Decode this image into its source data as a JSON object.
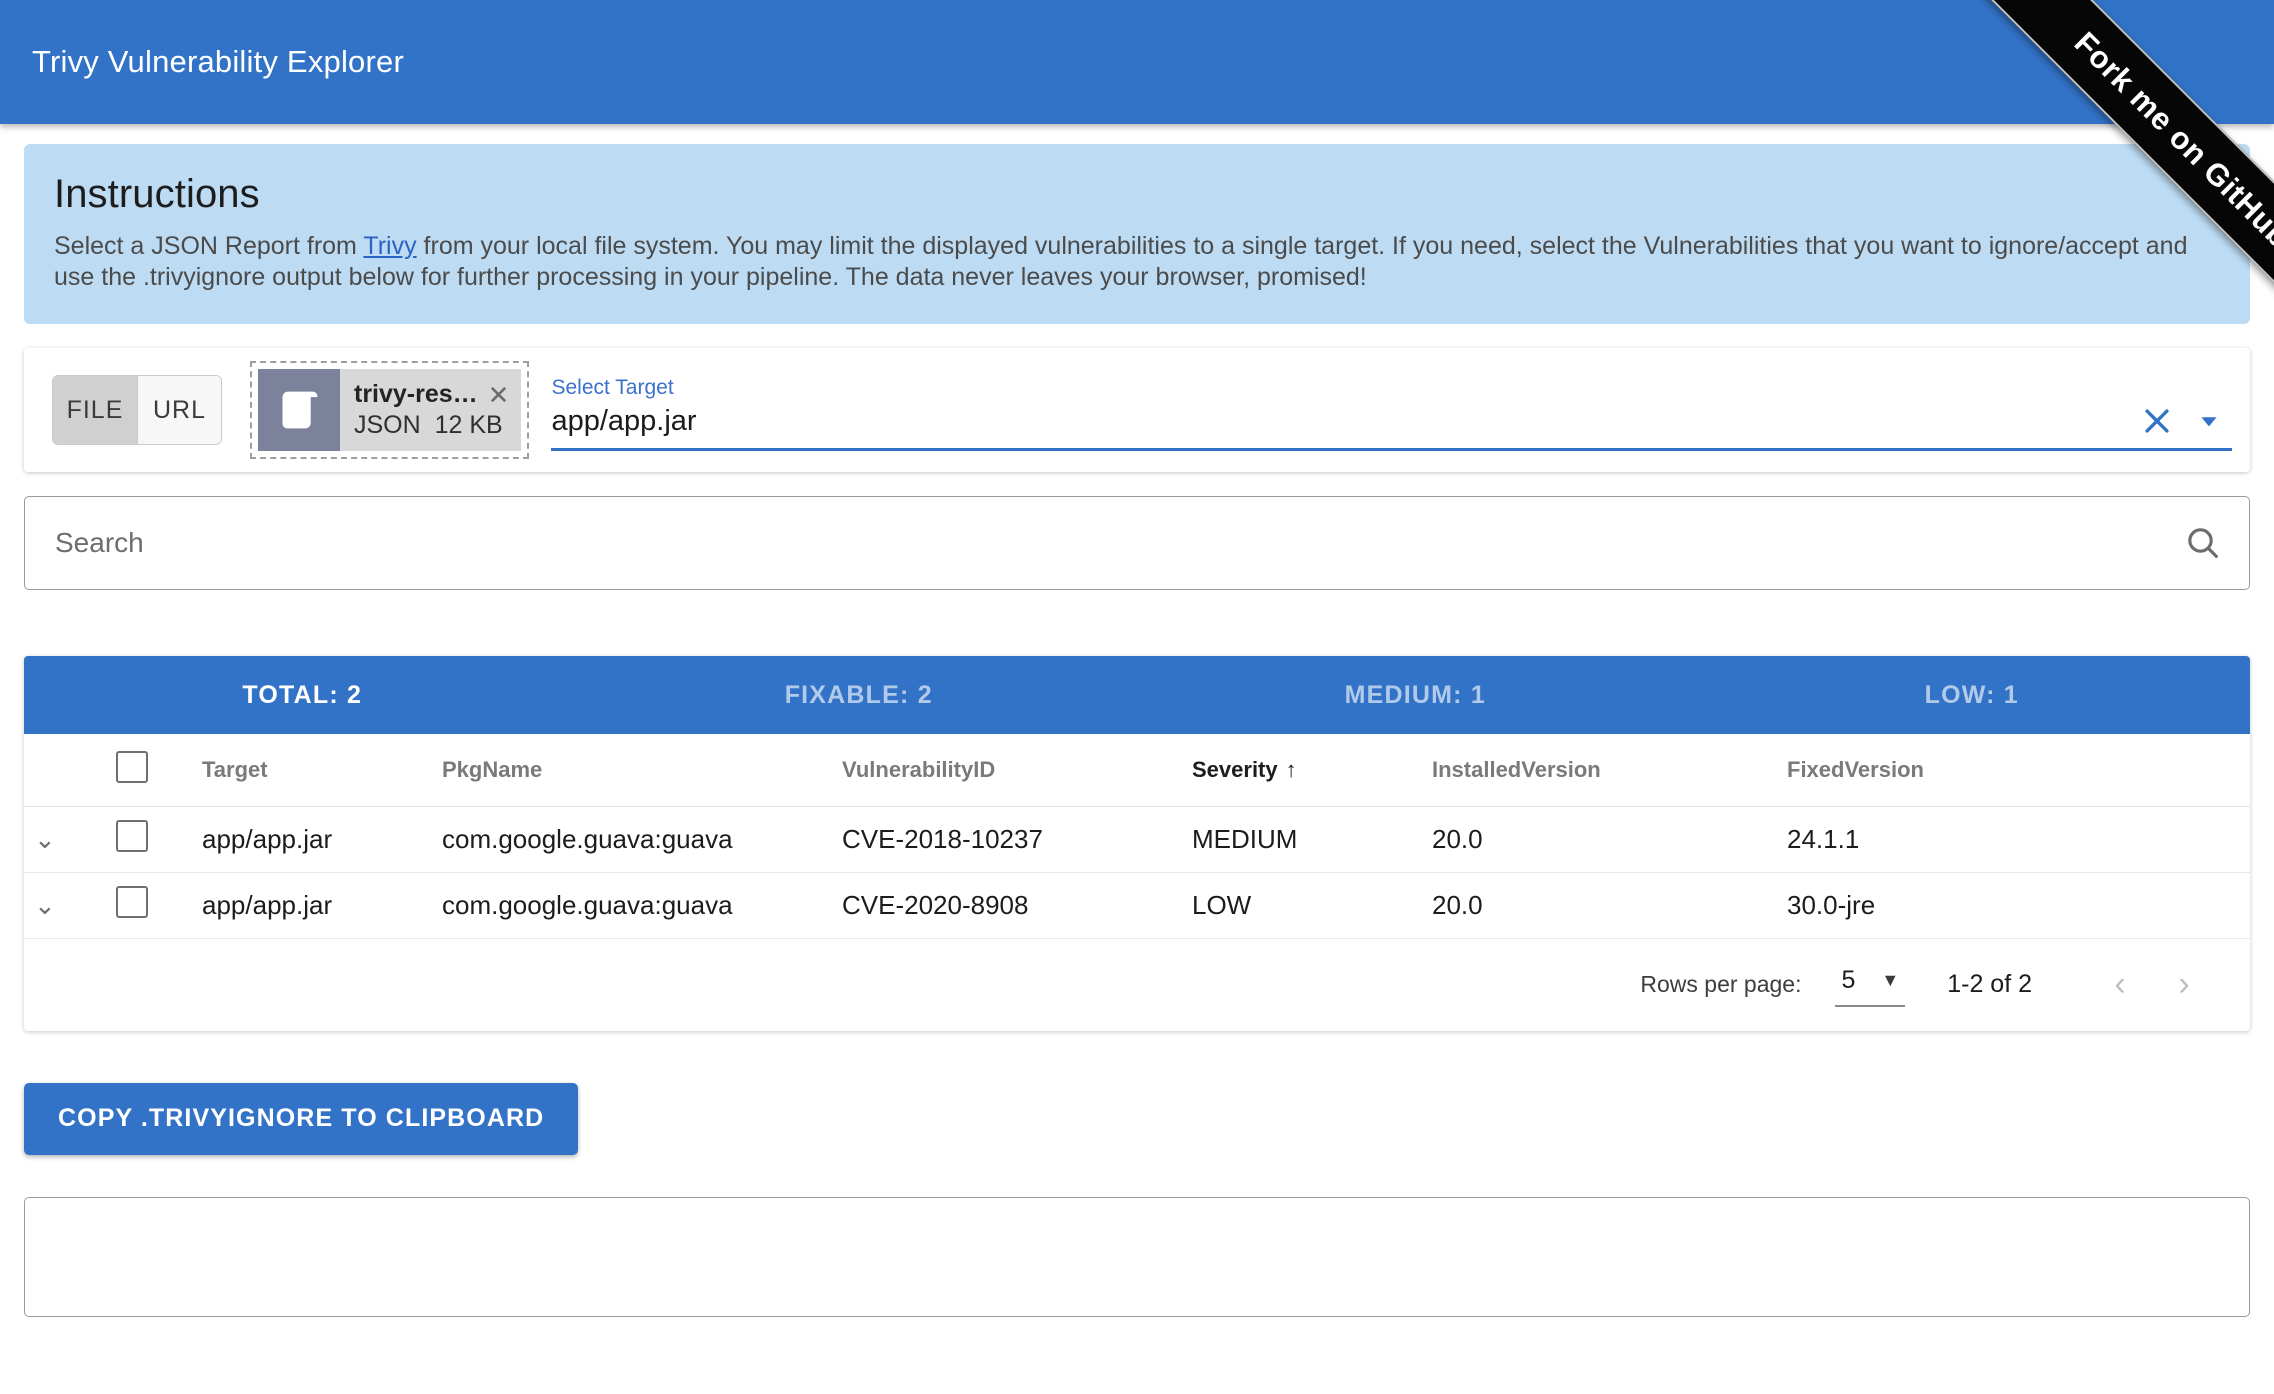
{
  "header": {
    "title": "Trivy Vulnerability Explorer",
    "ribbon_label": "Fork me on GitHub"
  },
  "instructions": {
    "heading": "Instructions",
    "text_before_link": "Select a JSON Report from ",
    "link_label": "Trivy",
    "text_after_link": " from your local file system. You may limit the displayed vulnerabilities to a single target. If you need, select the Vulnerabilities that you want to ignore/accept and use the .trivyignore output below for further processing in your pipeline. The data never leaves your browser, promised!"
  },
  "source": {
    "toggle": {
      "file_label": "FILE",
      "url_label": "URL",
      "selected": "FILE"
    },
    "file_chip": {
      "name": "trivy-res…",
      "type": "JSON",
      "size": "12 KB",
      "icon": "document-icon",
      "close_icon": "close-icon"
    },
    "target": {
      "label": "Select Target",
      "value": "app/app.jar",
      "clear_icon": "close-icon",
      "dropdown_icon": "chevron-down-icon"
    }
  },
  "search": {
    "placeholder": "Search",
    "icon": "search-icon"
  },
  "summary": {
    "total": "TOTAL: 2",
    "fixable": "FIXABLE: 2",
    "medium": "MEDIUM: 1",
    "low": "LOW: 1"
  },
  "table": {
    "columns": {
      "target": "Target",
      "pkgname": "PkgName",
      "vulnerabilityid": "VulnerabilityID",
      "severity": "Severity",
      "severity_sort": "↑",
      "installedversion": "InstalledVersion",
      "fixedversion": "FixedVersion"
    },
    "rows": [
      {
        "target": "app/app.jar",
        "pkgname": "com.google.guava:guava",
        "vulnerabilityid": "CVE-2018-10237",
        "severity": "MEDIUM",
        "installedversion": "20.0",
        "fixedversion": "24.1.1"
      },
      {
        "target": "app/app.jar",
        "pkgname": "com.google.guava:guava",
        "vulnerabilityid": "CVE-2020-8908",
        "severity": "LOW",
        "installedversion": "20.0",
        "fixedversion": "30.0-jre"
      }
    ]
  },
  "paginator": {
    "rows_per_page_label": "Rows per page:",
    "rows_per_page_value": "5",
    "range_label": "1-2 of 2",
    "prev_icon": "chevron-left-icon",
    "next_icon": "chevron-right-icon"
  },
  "actions": {
    "copy_label": "COPY .TRIVYIGNORE TO CLIPBOARD"
  },
  "output": {
    "value": ""
  },
  "colors": {
    "primary": "#3273c8",
    "instructions_bg": "#bddcf4",
    "ribbon_bg": "#060606",
    "link": "#2b63c4"
  }
}
